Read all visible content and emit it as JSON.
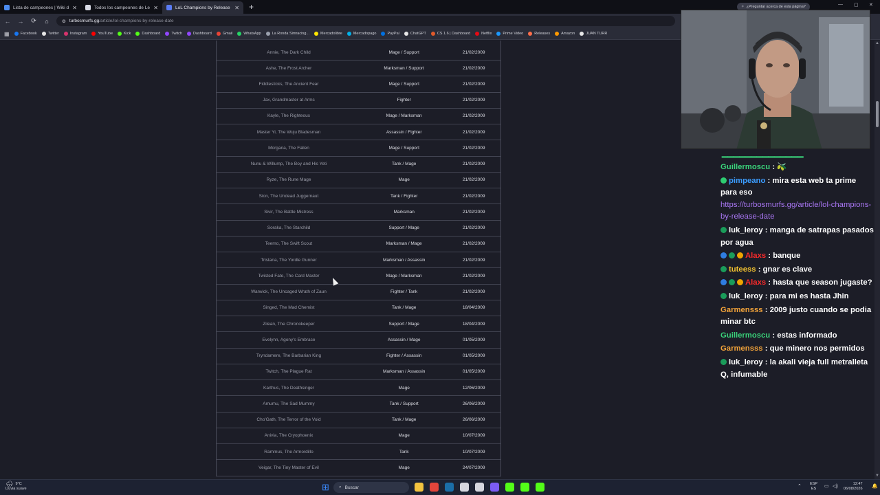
{
  "browser": {
    "tabs": [
      {
        "title": "Lista de campeones | Wiki de Le",
        "color": "#4c8cf0",
        "active": false
      },
      {
        "title": "Todos los campeones de League",
        "color": "#d9dbe6",
        "active": false
      },
      {
        "title": "LoL Champions by Release Da",
        "color": "#5a7cf5",
        "active": true
      }
    ],
    "new_tab_label": "+",
    "url_host": "turbosmurfs.gg",
    "url_path": "/article/lol-champions-by-release-date",
    "ask_page_label": "¿Preguntar acerca de esta página?",
    "bookmarks": [
      {
        "label": "Facebook",
        "color": "#1877f2"
      },
      {
        "label": "Twitter",
        "color": "#e7e7e7"
      },
      {
        "label": "Instagram",
        "color": "#d6336c"
      },
      {
        "label": "YouTube",
        "color": "#ff0000"
      },
      {
        "label": "Kick",
        "color": "#53fc18"
      },
      {
        "label": "Dashboard",
        "color": "#53fc18"
      },
      {
        "label": "Twitch",
        "color": "#9146ff"
      },
      {
        "label": "Dashboard",
        "color": "#9146ff"
      },
      {
        "label": "Gmail",
        "color": "#ea4335"
      },
      {
        "label": "WhatsApp",
        "color": "#25d366"
      },
      {
        "label": "La Ronda Simracing...",
        "color": "#9aa0ad"
      },
      {
        "label": "Mercadolibre",
        "color": "#ffe600"
      },
      {
        "label": "Mercadopago",
        "color": "#00b1ea"
      },
      {
        "label": "PayPal",
        "color": "#0070e0"
      },
      {
        "label": "ChatGPT",
        "color": "#e7e7e7"
      },
      {
        "label": "CS 1.6 | Dashboard",
        "color": "#e05a2b"
      },
      {
        "label": "Netflix",
        "color": "#e50914"
      },
      {
        "label": "Prime Video",
        "color": "#1a98ff"
      },
      {
        "label": "Releases",
        "color": "#ff6e4a"
      },
      {
        "label": "Amazon",
        "color": "#ff9900"
      },
      {
        "label": "JUAN TURR",
        "color": "#e7e7e7"
      }
    ]
  },
  "table": {
    "rows": [
      {
        "name": "Annie, The Dark Child",
        "role": "Mage / Support",
        "date": "21/02/2009"
      },
      {
        "name": "Ashe, The Frost Archer",
        "role": "Marksman / Support",
        "date": "21/02/2009"
      },
      {
        "name": "Fiddlesticks, The Ancient Fear",
        "role": "Mage / Support",
        "date": "21/02/2009"
      },
      {
        "name": "Jax, Grandmaster at Arms",
        "role": "Fighter",
        "date": "21/02/2009"
      },
      {
        "name": "Kayle, The Righteous",
        "role": "Mage / Marksman",
        "date": "21/02/2009"
      },
      {
        "name": "Master Yi, The Wuju Bladesman",
        "role": "Assassin / Fighter",
        "date": "21/02/2009"
      },
      {
        "name": "Morgana, The Fallen",
        "role": "Mage / Support",
        "date": "21/02/2009"
      },
      {
        "name": "Nunu & Willump, The Boy and His Yeti",
        "role": "Tank / Mage",
        "date": "21/02/2009"
      },
      {
        "name": "Ryze, The Rune Mage",
        "role": "Mage",
        "date": "21/02/2009"
      },
      {
        "name": "Sion, The Undead Juggernaut",
        "role": "Tank / Fighter",
        "date": "21/02/2009"
      },
      {
        "name": "Sivir, The Battle Mistress",
        "role": "Marksman",
        "date": "21/02/2009"
      },
      {
        "name": "Soraka, The Starchild",
        "role": "Support / Mage",
        "date": "21/02/2009"
      },
      {
        "name": "Teemo, The Swift Scout",
        "role": "Marksman / Mage",
        "date": "21/02/2009"
      },
      {
        "name": "Tristana, The Yordle Gunner",
        "role": "Marksman / Assassin",
        "date": "21/02/2009"
      },
      {
        "name": "Twisted Fate, The Card Master",
        "role": "Mage / Marksman",
        "date": "21/02/2009"
      },
      {
        "name": "Warwick, The Uncaged Wrath of Zaun",
        "role": "Fighter / Tank",
        "date": "21/02/2009"
      },
      {
        "name": "Singed, The Mad Chemist",
        "role": "Tank / Mage",
        "date": "18/04/2009"
      },
      {
        "name": "Zilean, The Chronokeeper",
        "role": "Support / Mage",
        "date": "18/04/2009"
      },
      {
        "name": "Evelynn, Agony's Embrace",
        "role": "Assassin / Mage",
        "date": "01/05/2009"
      },
      {
        "name": "Tryndamere, The Barbarian King",
        "role": "Fighter / Assassin",
        "date": "01/05/2009"
      },
      {
        "name": "Twitch, The Plague Rat",
        "role": "Marksman / Assassin",
        "date": "01/05/2009"
      },
      {
        "name": "Karthus, The Deathsinger",
        "role": "Mage",
        "date": "12/06/2009"
      },
      {
        "name": "Amumu, The Sad Mummy",
        "role": "Tank / Support",
        "date": "26/06/2009"
      },
      {
        "name": "Cho'Gath, The Terror of the Void",
        "role": "Tank / Mage",
        "date": "26/06/2009"
      },
      {
        "name": "Anivia, The Cryophoenix",
        "role": "Mage",
        "date": "10/07/2009"
      },
      {
        "name": "Rammus, The Armordillo",
        "role": "Tank",
        "date": "10/07/2009"
      },
      {
        "name": "Veigar, The Tiny Master of Evil",
        "role": "Mage",
        "date": "24/07/2009"
      }
    ]
  },
  "chat": {
    "messages": [
      {
        "user": "Guillermoscu",
        "user_color": "#3ad27a",
        "text": ": 🫒",
        "badges": []
      },
      {
        "user": "pimpeano",
        "user_color": "#3b9cff",
        "text": ": mira esta web ta prime para eso",
        "badges": [
          "#2ecc71"
        ],
        "link": "https://turbosmurfs.gg/article/lol-champions-by-release-date"
      },
      {
        "user": "luk_leroy",
        "user_color": "#ffffff",
        "text": ": manga de satrapas pasados por agua",
        "badges": [
          "#1a9c5a"
        ]
      },
      {
        "user": "Alaxs",
        "user_color": "#ff2a2a",
        "text": ": banque",
        "badges": [
          "#2f7de1",
          "#1a9c5a",
          "#f0a500"
        ]
      },
      {
        "user": "tuteess",
        "user_color": "#f2c230",
        "text": ": gnar es clave",
        "badges": [
          "#1a9c5a"
        ]
      },
      {
        "user": "Alaxs",
        "user_color": "#ff2a2a",
        "text": ": hasta que season jugaste?",
        "badges": [
          "#2f7de1",
          "#1a9c5a",
          "#f0a500"
        ]
      },
      {
        "user": "luk_leroy",
        "user_color": "#ffffff",
        "text": ": para mi es hasta Jhin",
        "badges": [
          "#1a9c5a"
        ]
      },
      {
        "user": "Garmensss",
        "user_color": "#f2a33a",
        "text": ": 2009 justo cuando se podia minar btc",
        "badges": []
      },
      {
        "user": "Guillermoscu",
        "user_color": "#3ad27a",
        "text": ": estas informado",
        "badges": []
      },
      {
        "user": "Garmensss",
        "user_color": "#f2a33a",
        "text": ": que minero nos permidos",
        "badges": []
      },
      {
        "user": "luk_leroy",
        "user_color": "#ffffff",
        "text": ": la akali vieja full metralleta Q, infumable",
        "badges": [
          "#1a9c5a"
        ]
      }
    ]
  },
  "taskbar": {
    "weather_temp": "9°C",
    "weather_desc": "Lluvia suave",
    "search_placeholder": "Buscar",
    "lang_top": "ESP",
    "lang_bottom": "ES",
    "time": "12:47",
    "date": "06/08/2026",
    "apps": [
      {
        "name": "file-explorer-icon",
        "color": "#f3c33f"
      },
      {
        "name": "chrome-icon",
        "color": "#e2453b"
      },
      {
        "name": "steam-icon",
        "color": "#1b6ea8"
      },
      {
        "name": "obs-icon",
        "color": "#d6d7df"
      },
      {
        "name": "capcut-icon",
        "color": "#d6d7df"
      },
      {
        "name": "discord-icon",
        "color": "#7b5cf5"
      },
      {
        "name": "kick-icon",
        "color": "#53fc18"
      },
      {
        "name": "kick-studio-icon",
        "color": "#53fc18"
      },
      {
        "name": "kick-app-icon",
        "color": "#53fc18"
      }
    ]
  }
}
